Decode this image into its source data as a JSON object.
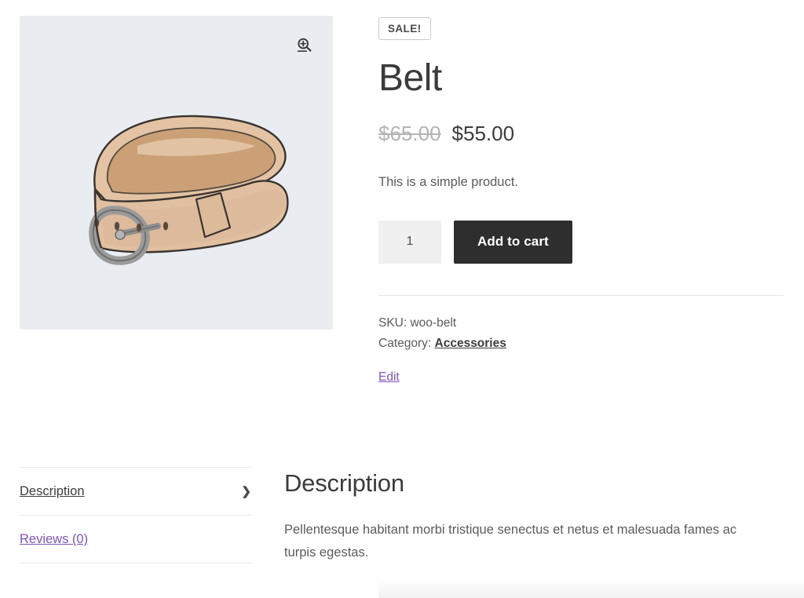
{
  "product": {
    "sale_badge": "SALE!",
    "title": "Belt",
    "price_old": "$65.00",
    "price_new": "$55.00",
    "short_description": "This is a simple product.",
    "quantity_value": "1",
    "quantity_placeholder": "1",
    "add_to_cart_label": "Add to cart",
    "sku_line": "SKU: woo-belt",
    "category_prefix": "Category:",
    "category_name": "Accessories",
    "edit_label": "Edit",
    "image_alt": "Belt",
    "zoom_icon": "magnifier-plus-icon"
  },
  "colors": {
    "gallery_background": "#e9edf1",
    "add_to_cart_background": "#2e2e2e",
    "link_purple": "#7f54b3",
    "text_primary": "#3c3c3c",
    "text_muted": "#5b5b5b",
    "price_old": "#b4b4b4",
    "divider": "#e6e6e6"
  },
  "tabs": [
    {
      "label": "Description",
      "active": true,
      "chevron": "❯"
    },
    {
      "label": "Reviews (0)",
      "active": false,
      "chevron": ""
    }
  ],
  "panel": {
    "title": "Description",
    "body": "Pellentesque habitant morbi tristique senectus et netus et malesuada fames ac turpis egestas."
  }
}
